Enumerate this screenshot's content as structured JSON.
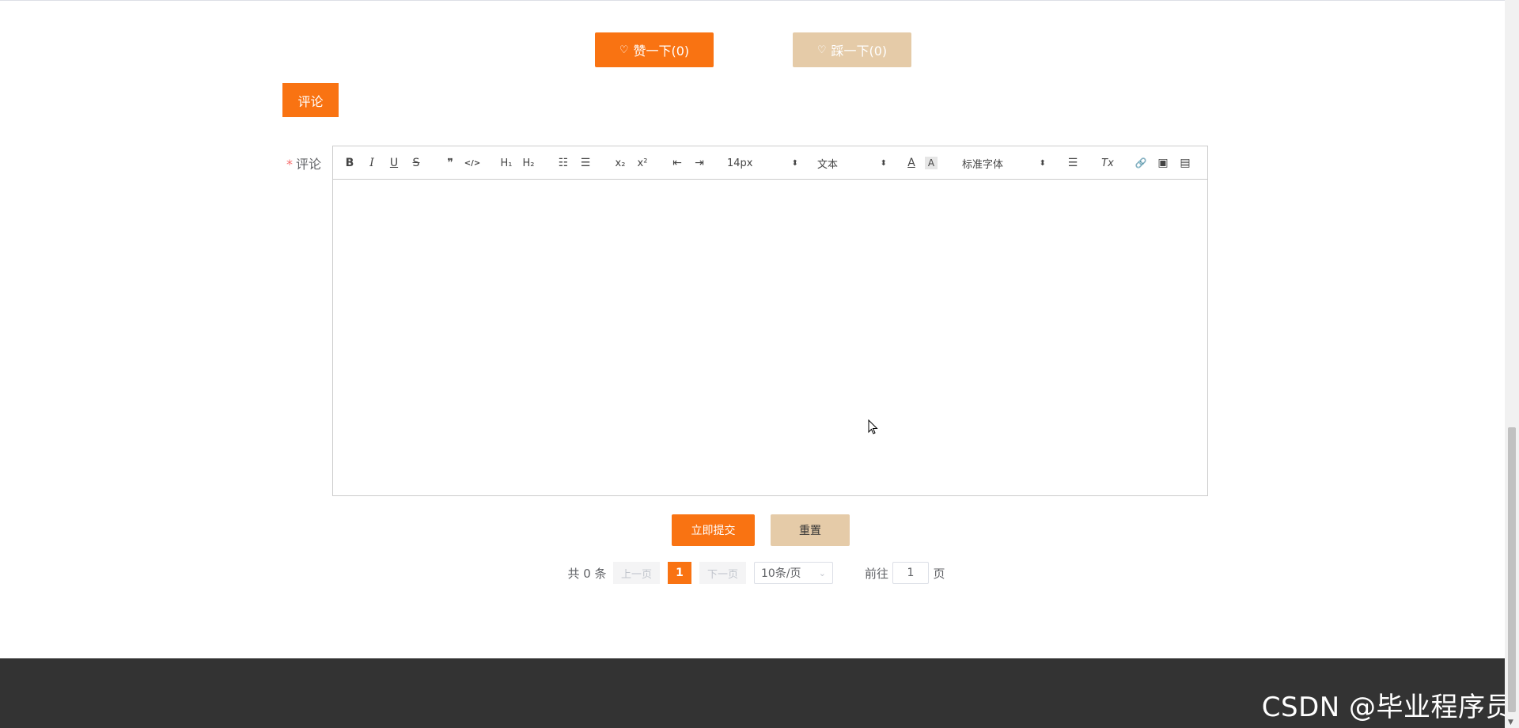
{
  "vote": {
    "like_label": "赞一下(0)",
    "dislike_label": "踩一下(0)"
  },
  "comment_tab": "评论",
  "form": {
    "required_mark": "*",
    "comment_label": "评论"
  },
  "editor": {
    "toolbar": {
      "bold": "B",
      "italic": "I",
      "underline": "U",
      "strike": "S",
      "quote": "❞",
      "code": "</>",
      "h1": "H₁",
      "h2": "H₂",
      "ordered_list": "☷",
      "bullet_list": "☰",
      "subscript": "x₂",
      "superscript": "x²",
      "outdent": "⇤",
      "indent": "⇥",
      "font_size": "14px",
      "header": "文本",
      "color": "A",
      "background": "A",
      "font_family": "标准字体",
      "align": "☰",
      "clean": "Tx",
      "link": "🔗",
      "image": "▣",
      "video": "▤",
      "select_arrow": "⬍"
    },
    "content": ""
  },
  "actions": {
    "submit_label": "立即提交",
    "reset_label": "重置"
  },
  "pagination": {
    "total_text": "共 0 条",
    "prev_label": "上一页",
    "current_page": "1",
    "next_label": "下一页",
    "page_size": "10条/页",
    "goto_prefix": "前往",
    "goto_value": "1",
    "goto_suffix": "页"
  },
  "footer": {
    "watermark": "CSDN @毕业程序员"
  },
  "icons": {
    "like": "♡",
    "dislike": "♡",
    "chevron": "⌄"
  },
  "colors": {
    "accent": "#f97312",
    "secondary": "#e5cba8",
    "footer": "#333333"
  }
}
